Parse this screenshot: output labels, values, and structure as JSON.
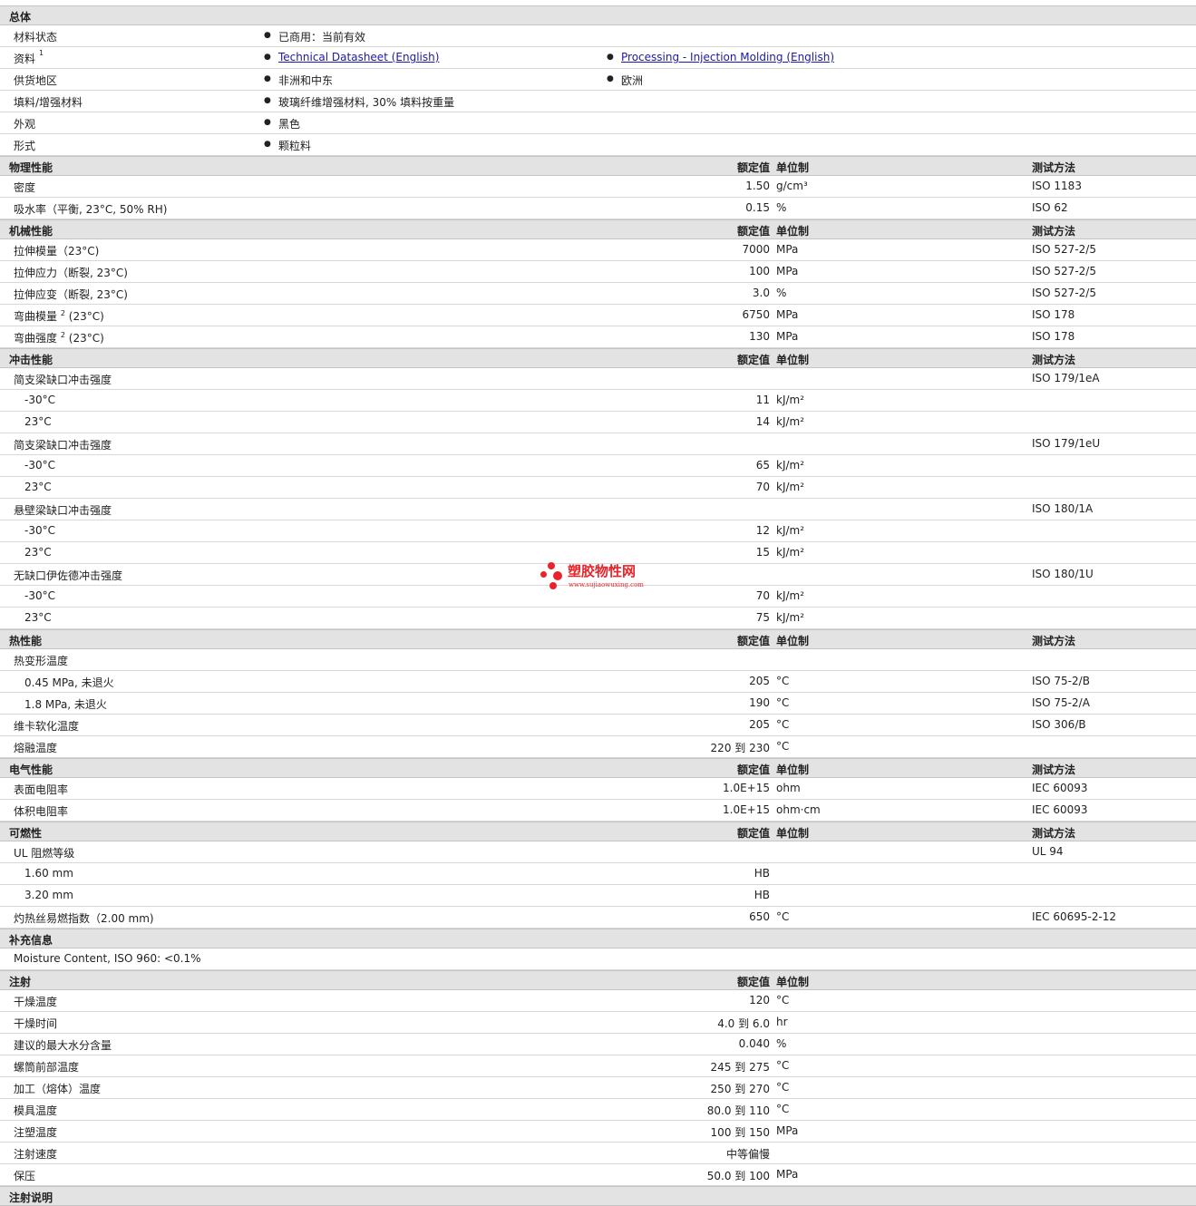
{
  "headers": {
    "value": "额定值",
    "unit": "单位制",
    "method": "测试方法"
  },
  "general": {
    "title": "总体",
    "rows": [
      {
        "name": "材料状态",
        "items": [
          "已商用：当前有效"
        ]
      },
      {
        "name": "资料",
        "sup": "1",
        "items": [
          "Technical Datasheet (English)",
          "Processing - Injection Molding (English)"
        ],
        "links": true
      },
      {
        "name": "供货地区",
        "items": [
          "非洲和中东",
          "欧洲"
        ]
      },
      {
        "name": "填料/增强材料",
        "items": [
          "玻璃纤维增强材料, 30% 填料按重量"
        ]
      },
      {
        "name": "外观",
        "items": [
          "黑色"
        ]
      },
      {
        "name": "形式",
        "items": [
          "颗粒料"
        ]
      }
    ]
  },
  "sections": [
    {
      "title": "物理性能",
      "showHeaders": true,
      "rows": [
        {
          "name": "密度",
          "value": "1.50",
          "unit": "g/cm³",
          "method": "ISO 1183"
        },
        {
          "name": "吸水率（平衡, 23°C, 50% RH)",
          "value": "0.15",
          "unit": "%",
          "method": "ISO 62"
        }
      ]
    },
    {
      "title": "机械性能",
      "showHeaders": true,
      "rows": [
        {
          "name": "拉伸模量（23°C)",
          "value": "7000",
          "unit": "MPa",
          "method": "ISO 527-2/5"
        },
        {
          "name": "拉伸应力（断裂, 23°C)",
          "value": "100",
          "unit": "MPa",
          "method": "ISO 527-2/5"
        },
        {
          "name": "拉伸应变（断裂, 23°C)",
          "value": "3.0",
          "unit": "%",
          "method": "ISO 527-2/5"
        },
        {
          "name": "弯曲模量",
          "sup": "2",
          "suffix": "(23°C)",
          "value": "6750",
          "unit": "MPa",
          "method": "ISO 178"
        },
        {
          "name": "弯曲强度",
          "sup": "2",
          "suffix": "(23°C)",
          "value": "130",
          "unit": "MPa",
          "method": "ISO 178"
        }
      ]
    },
    {
      "title": "冲击性能",
      "showHeaders": true,
      "rows": [
        {
          "name": "简支梁缺口冲击强度",
          "method": "ISO 179/1eA"
        },
        {
          "name": "-30°C",
          "sub": true,
          "value": "11",
          "unit": "kJ/m²"
        },
        {
          "name": "23°C",
          "sub": true,
          "value": "14",
          "unit": "kJ/m²"
        },
        {
          "name": "简支梁缺口冲击强度",
          "method": "ISO 179/1eU"
        },
        {
          "name": "-30°C",
          "sub": true,
          "value": "65",
          "unit": "kJ/m²"
        },
        {
          "name": "23°C",
          "sub": true,
          "value": "70",
          "unit": "kJ/m²"
        },
        {
          "name": "悬壁梁缺口冲击强度",
          "method": "ISO 180/1A"
        },
        {
          "name": "-30°C",
          "sub": true,
          "value": "12",
          "unit": "kJ/m²"
        },
        {
          "name": "23°C",
          "sub": true,
          "value": "15",
          "unit": "kJ/m²"
        },
        {
          "name": "无缺口伊佐德冲击强度",
          "method": "ISO 180/1U"
        },
        {
          "name": "-30°C",
          "sub": true,
          "value": "70",
          "unit": "kJ/m²"
        },
        {
          "name": "23°C",
          "sub": true,
          "value": "75",
          "unit": "kJ/m²"
        }
      ]
    },
    {
      "title": "热性能",
      "showHeaders": true,
      "rows": [
        {
          "name": "热变形温度"
        },
        {
          "name": "0.45 MPa, 未退火",
          "sub": true,
          "value": "205",
          "unit": "°C",
          "method": "ISO 75-2/B"
        },
        {
          "name": "1.8 MPa, 未退火",
          "sub": true,
          "value": "190",
          "unit": "°C",
          "method": "ISO 75-2/A"
        },
        {
          "name": "维卡软化温度",
          "value": "205",
          "unit": "°C",
          "method": "ISO 306/B"
        },
        {
          "name": "熔融温度",
          "value": "220 到  230",
          "unit": "°C"
        }
      ]
    },
    {
      "title": "电气性能",
      "showHeaders": true,
      "rows": [
        {
          "name": "表面电阻率",
          "value": "1.0E+15",
          "unit": "ohm",
          "method": "IEC 60093"
        },
        {
          "name": "体积电阻率",
          "value": "1.0E+15",
          "unit": "ohm·cm",
          "method": "IEC 60093"
        }
      ]
    },
    {
      "title": "可燃性",
      "showHeaders": true,
      "rows": [
        {
          "name": "UL 阻燃等级",
          "method": "UL 94"
        },
        {
          "name": "1.60 mm",
          "sub": true,
          "value": "HB"
        },
        {
          "name": "3.20 mm",
          "sub": true,
          "value": "HB"
        },
        {
          "name": "灼热丝易燃指数（2.00 mm)",
          "value": "650",
          "unit": "°C",
          "method": "IEC 60695-2-12"
        }
      ]
    },
    {
      "title": "补充信息",
      "showHeaders": false,
      "rows": [
        {
          "name": "Moisture Content, ISO 960: <0.1%"
        }
      ]
    },
    {
      "title": "注射",
      "showHeaders": true,
      "noMethod": true,
      "rows": [
        {
          "name": "干燥温度",
          "value": "120",
          "unit": "°C"
        },
        {
          "name": "干燥时间",
          "value": "4.0 到  6.0",
          "unit": "hr"
        },
        {
          "name": "建议的最大水分含量",
          "value": "0.040",
          "unit": "%"
        },
        {
          "name": "螺筒前部温度",
          "value": "245 到  275",
          "unit": "°C"
        },
        {
          "name": "加工（熔体）温度",
          "value": "250 到  270",
          "unit": "°C"
        },
        {
          "name": "模具温度",
          "value": "80.0 到  110",
          "unit": "°C"
        },
        {
          "name": "注塑温度",
          "value": "100 到  150",
          "unit": "MPa"
        },
        {
          "name": "注射速度",
          "value": "中等偏慢"
        },
        {
          "name": "保压",
          "value": "50.0 到  100",
          "unit": "MPa"
        }
      ]
    },
    {
      "title": "注射说明",
      "showHeaders": false,
      "rows": []
    }
  ],
  "watermark": {
    "text": "塑胶物性网",
    "url": "www.sujiaowuxing.com"
  }
}
